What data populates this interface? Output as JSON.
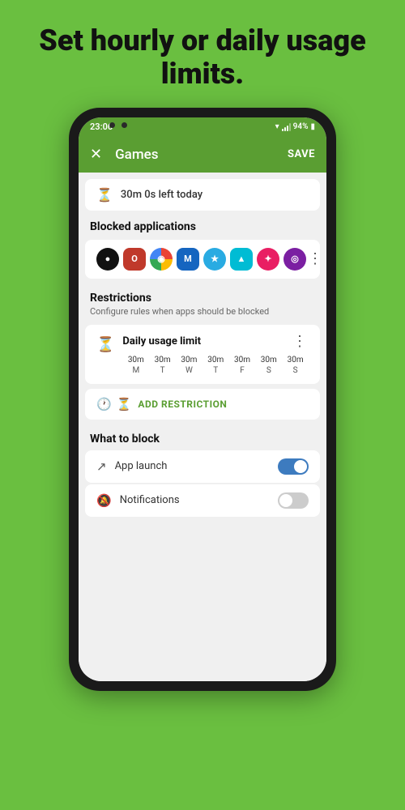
{
  "headline": "Set hourly or daily usage limits.",
  "phone": {
    "status_bar": {
      "time": "23:06",
      "battery": "94%"
    },
    "app_bar": {
      "title": "Games",
      "save_label": "SAVE"
    },
    "timer_section": {
      "text": "30m 0s left today"
    },
    "blocked_apps_section": {
      "title": "Blocked applications"
    },
    "apps": [
      {
        "color": "#111111",
        "label": "●"
      },
      {
        "color": "#c0392b",
        "label": "O"
      },
      {
        "color": "#4285F4",
        "label": "◉"
      },
      {
        "color": "#1565C0",
        "label": "M"
      },
      {
        "color": "#29ABE2",
        "label": "★"
      },
      {
        "color": "#00BCD4",
        "label": "▲"
      },
      {
        "color": "#E91E63",
        "label": "✦"
      },
      {
        "color": "#7B1FA2",
        "label": "◎"
      }
    ],
    "restrictions_section": {
      "title": "Restrictions",
      "subtitle": "Configure rules when apps should be blocked"
    },
    "daily_limit": {
      "title": "Daily usage limit",
      "times": [
        "30m",
        "30m",
        "30m",
        "30m",
        "30m",
        "30m",
        "30m"
      ],
      "days": [
        "M",
        "T",
        "W",
        "T",
        "F",
        "S",
        "S"
      ]
    },
    "add_restriction": {
      "label": "ADD RESTRICTION"
    },
    "what_to_block": {
      "title": "What to block",
      "items": [
        {
          "icon": "↗",
          "label": "App launch",
          "toggle": "on"
        },
        {
          "icon": "🔕",
          "label": "Notifications",
          "toggle": "off"
        }
      ]
    }
  }
}
